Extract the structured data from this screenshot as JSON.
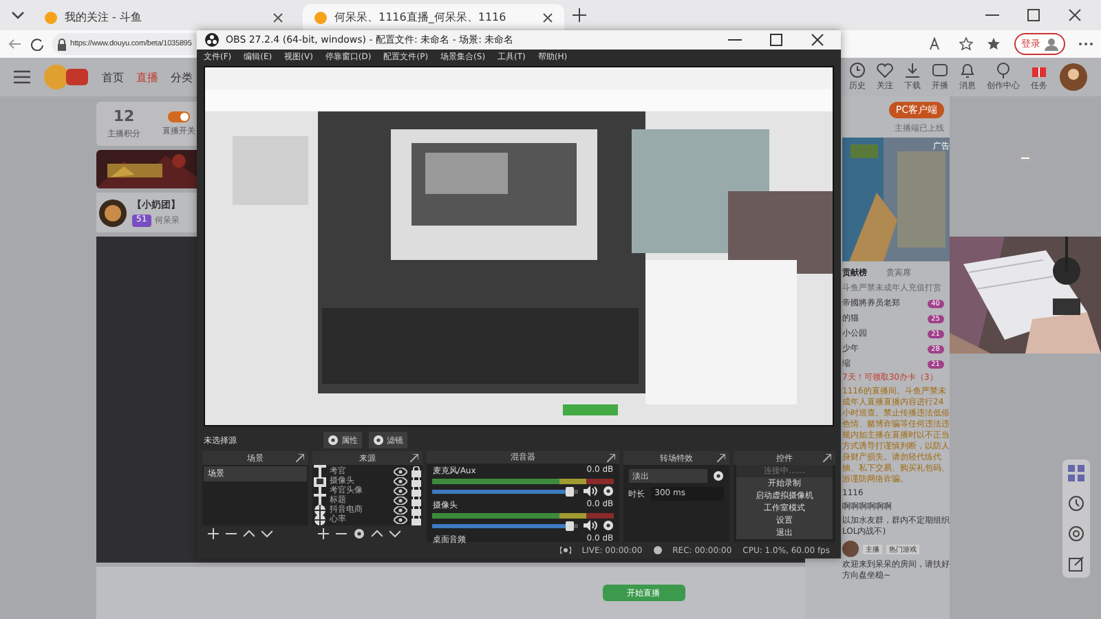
{
  "browser": {
    "tabs": [
      {
        "title": "我的关注 - 斗鱼",
        "selected": false
      },
      {
        "title": "何呆呆、1116直播_何呆呆、1116",
        "selected": true
      }
    ],
    "url": "https://www.douyu.com/beta/1035895",
    "login": "登录"
  },
  "page": {
    "nav": [
      {
        "label": "首页",
        "selected": false
      },
      {
        "label": "直播",
        "selected": true
      },
      {
        "label": "分类",
        "selected": false
      }
    ],
    "top_icons": [
      {
        "kind": "history",
        "label": "历史"
      },
      {
        "kind": "heart",
        "label": "关注"
      },
      {
        "kind": "download",
        "label": "下载"
      },
      {
        "kind": "live",
        "label": "开播"
      },
      {
        "kind": "bell",
        "label": "消息"
      },
      {
        "kind": "pin",
        "label": "创作中心"
      },
      {
        "kind": "gift",
        "label": "任务"
      }
    ],
    "score": "12",
    "score_label": "主播积分",
    "switch_label": "直播开关",
    "switch_on": true,
    "streamer_title": "【小奶团】",
    "streamer_level": "51",
    "streamer_name": "何呆呆",
    "client_button": "PC客户端",
    "client_note": "主播端已上线",
    "ad_label": "广告",
    "rank_tabs": [
      {
        "label": "贡献榜",
        "selected": true
      },
      {
        "label": "贵宾席",
        "selected": false
      }
    ],
    "rank_notice": "斗鱼严禁未成年人充值打赏",
    "ranks": [
      {
        "name": "帝國將养员老郑",
        "level": "40"
      },
      {
        "name": "的猫",
        "level": "25"
      },
      {
        "name": "小公园",
        "level": "21"
      },
      {
        "name": "少年",
        "level": "28"
      },
      {
        "name": "缩",
        "level": "21"
      }
    ],
    "chat": [
      {
        "kind": "promo",
        "text": "7天！可领取30办卡（3）"
      },
      {
        "kind": "system",
        "text": "1116的直播间。斗鱼严禁未成年人直播直播内容进行24小时巡查。禁止传播违法低俗色情、赌博诈骗等任何违法违规内如主播在直播时以不正当方式诱导打谨慎判断，以防人身财产损失。请勿轻代练代抽、私下交易、购买礼包码、游谨防网络诈骗。"
      },
      {
        "kind": "plain",
        "text": "1116"
      },
      {
        "kind": "plain",
        "text": "啊啊啊啊啊啊"
      },
      {
        "kind": "plain",
        "text": "以加水友群，群内不定期组织LOL内战不)"
      }
    ],
    "host_tags": [
      "主播",
      "热门游戏"
    ],
    "welcome": "欢迎来到呆呆的房间，请扶好方向盘坐稳~",
    "bottom_button": "开始直播"
  },
  "obs": {
    "title": "OBS 27.2.4 (64-bit, windows) - 配置文件: 未命名 - 场景: 未命名",
    "menu": [
      "文件(F)",
      "编辑(E)",
      "视图(V)",
      "停靠窗口(D)",
      "配置文件(P)",
      "场景集合(S)",
      "工具(T)",
      "帮助(H)"
    ],
    "no_source": "未选择源",
    "source_buttons": [
      "属性",
      "滤镜"
    ],
    "docks": [
      "场景",
      "来源",
      "混音器",
      "转场特效",
      "控件"
    ],
    "scenes": [
      {
        "name": "场景",
        "selected": true
      }
    ],
    "sources": [
      {
        "kind": "text",
        "name": "考官"
      },
      {
        "kind": "camera",
        "name": "摄像头"
      },
      {
        "kind": "text",
        "name": "考官头像"
      },
      {
        "kind": "text",
        "name": "标题"
      },
      {
        "kind": "browser",
        "name": "抖音电商"
      },
      {
        "kind": "browser",
        "name": "心率"
      }
    ],
    "mixer": [
      {
        "name": "麦克风/Aux",
        "reading": "0.0 dB",
        "level": 0.95
      },
      {
        "name": "摄像头",
        "reading": "0.0 dB",
        "level": 0.95
      },
      {
        "name": "桌面音频",
        "reading": "0.0 dB"
      }
    ],
    "transition": "淡出",
    "duration_label": "时长",
    "duration": "300 ms",
    "controls": [
      {
        "label": "连接中……",
        "disabled": true
      },
      {
        "label": "开始录制",
        "disabled": false
      },
      {
        "label": "启动虚拟摄像机",
        "disabled": false
      },
      {
        "label": "工作室模式",
        "disabled": false
      },
      {
        "label": "设置",
        "disabled": false
      },
      {
        "label": "退出",
        "disabled": false
      }
    ],
    "status": {
      "live": "LIVE: 00:00:00",
      "rec": "REC: 00:00:00",
      "cpu": "CPU: 1.0%, 60.00 fps"
    }
  }
}
